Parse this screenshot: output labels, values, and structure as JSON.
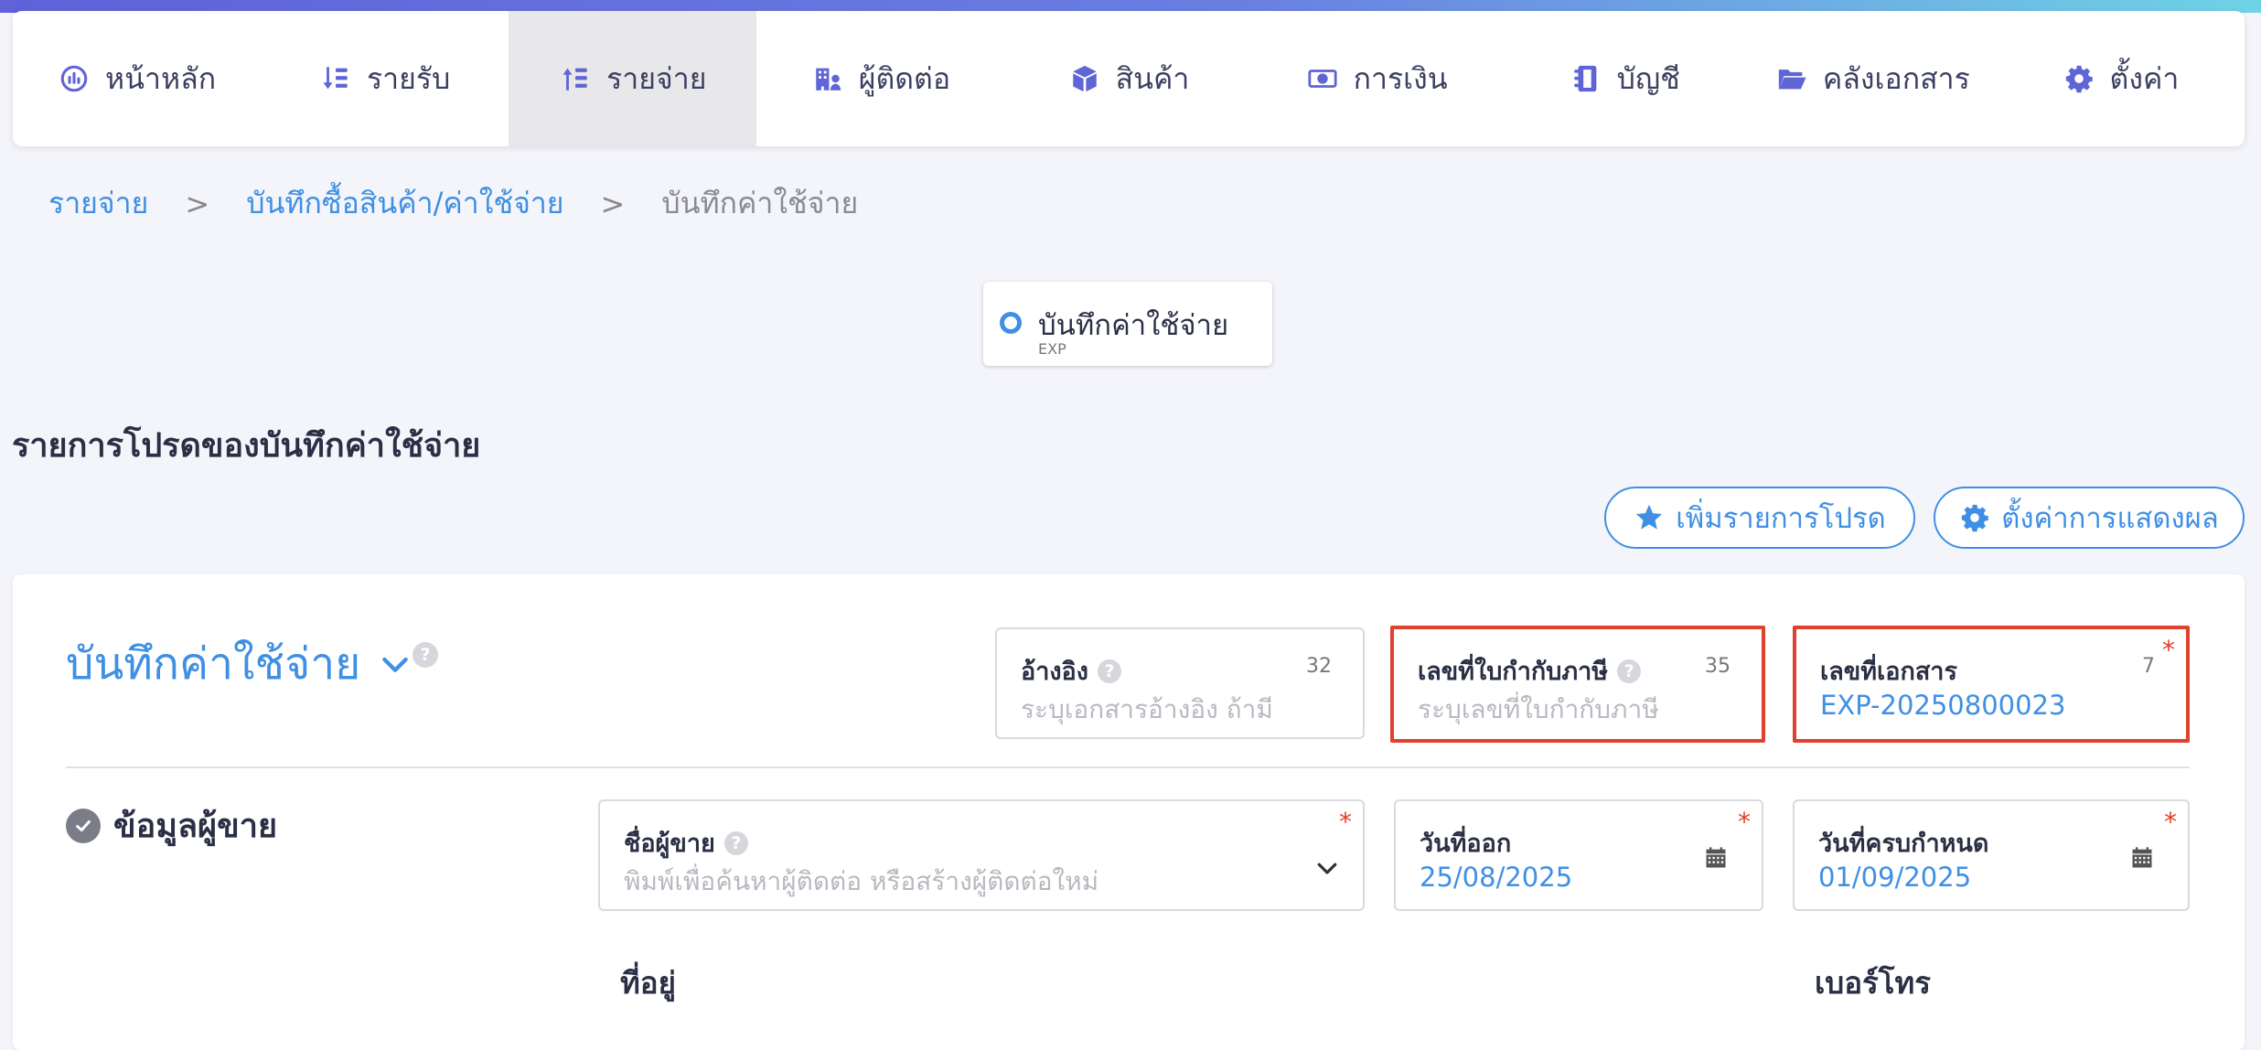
{
  "nav": {
    "items": [
      {
        "label": "หน้าหลัก",
        "icon": "dashboard-gauge-icon"
      },
      {
        "label": "รายรับ",
        "icon": "income-sort-icon"
      },
      {
        "label": "รายจ่าย",
        "icon": "expense-sort-icon",
        "active": true
      },
      {
        "label": "ผู้ติดต่อ",
        "icon": "contacts-building-icon"
      },
      {
        "label": "สินค้า",
        "icon": "product-box-icon"
      },
      {
        "label": "การเงิน",
        "icon": "money-bill-icon"
      },
      {
        "label": "บัญชี",
        "icon": "account-book-icon"
      },
      {
        "label": "คลังเอกสาร",
        "icon": "folder-open-icon"
      },
      {
        "label": "ตั้งค่า",
        "icon": "gear-icon"
      }
    ]
  },
  "breadcrumb": {
    "level1": "รายจ่าย",
    "level2": "บันทึกซื้อสินค้า/ค่าใช้จ่าย",
    "current": "บันทึกค่าใช้จ่าย",
    "separator": ">"
  },
  "doc_type": {
    "label": "บันทึกค่าใช้จ่าย",
    "code": "EXP"
  },
  "favorites": {
    "title": "รายการโปรดของบันทึกค่าใช้จ่าย",
    "add_button": "เพิ่มรายการโปรด",
    "settings_button": "ตั้งค่าการแสดงผล"
  },
  "form": {
    "title": "บันทึกค่าใช้จ่าย",
    "reference": {
      "label": "อ้างอิง",
      "count": "32",
      "placeholder": "ระบุเอกสารอ้างอิง ถ้ามี"
    },
    "tax_invoice": {
      "label": "เลขที่ใบกำกับภาษี",
      "count": "35",
      "placeholder": "ระบุเลขที่ใบกำกับภาษี"
    },
    "document_no": {
      "label": "เลขที่เอกสาร",
      "count": "7",
      "value": "EXP-20250800023",
      "required": "*"
    },
    "vendor_section": {
      "title": "ข้อมูลผู้ขาย",
      "vendor_name": {
        "label": "ชื่อผู้ขาย",
        "placeholder": "พิมพ์เพื่อค้นหาผู้ติดต่อ หรือสร้างผู้ติดต่อใหม่",
        "required": "*"
      },
      "issue_date": {
        "label": "วันที่ออก",
        "value": "25/08/2025",
        "required": "*"
      },
      "due_date": {
        "label": "วันที่ครบกำหนด",
        "value": "01/09/2025",
        "required": "*"
      },
      "address_label": "ที่อยู่",
      "phone_label": "เบอร์โทร"
    }
  },
  "help_mark": "?",
  "colors": {
    "accent": "#3f8fe4",
    "nav_icon": "#6065d6",
    "highlight": "#e0412e"
  }
}
